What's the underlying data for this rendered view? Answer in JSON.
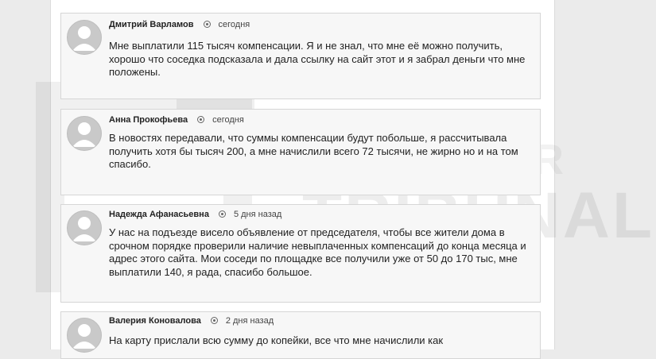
{
  "watermark": {
    "line1": "BROKER",
    "line2": "TRIBUNAL"
  },
  "comments": [
    {
      "author": "Дмитрий Варламов",
      "time": "сегодня",
      "text": "Мне выплатили 115 тысяч компенсации. Я и не знал, что мне её можно получить, хорошо что соседка подсказала и дала ссылку на сайт этот и я забрал деньги что мне положены."
    },
    {
      "author": "Анна Прокофьева",
      "time": "сегодня",
      "text": "В новостях передавали, что суммы компенсации будут побольше, я рассчитывала получить хотя бы тысяч 200, а мне начислили всего 72 тысячи, не жирно но и на том спасибо."
    },
    {
      "author": "Надежда Афанасьевна",
      "time": "5 дня назад",
      "text": "У нас на подъезде висело объявление от председателя, чтобы все жители дома в срочном порядке проверили наличие невыплаченных компенсаций до конца месяца и адрес этого сайта. Мои соседи по площадке все получили уже от 50 до 170 тыс, мне выплатили 140, я рада, спасибо большое."
    },
    {
      "author": "Валерия Коновалова",
      "time": "2 дня назад",
      "text": "На карту прислали всю сумму до копейки, все что мне начислили как"
    }
  ]
}
